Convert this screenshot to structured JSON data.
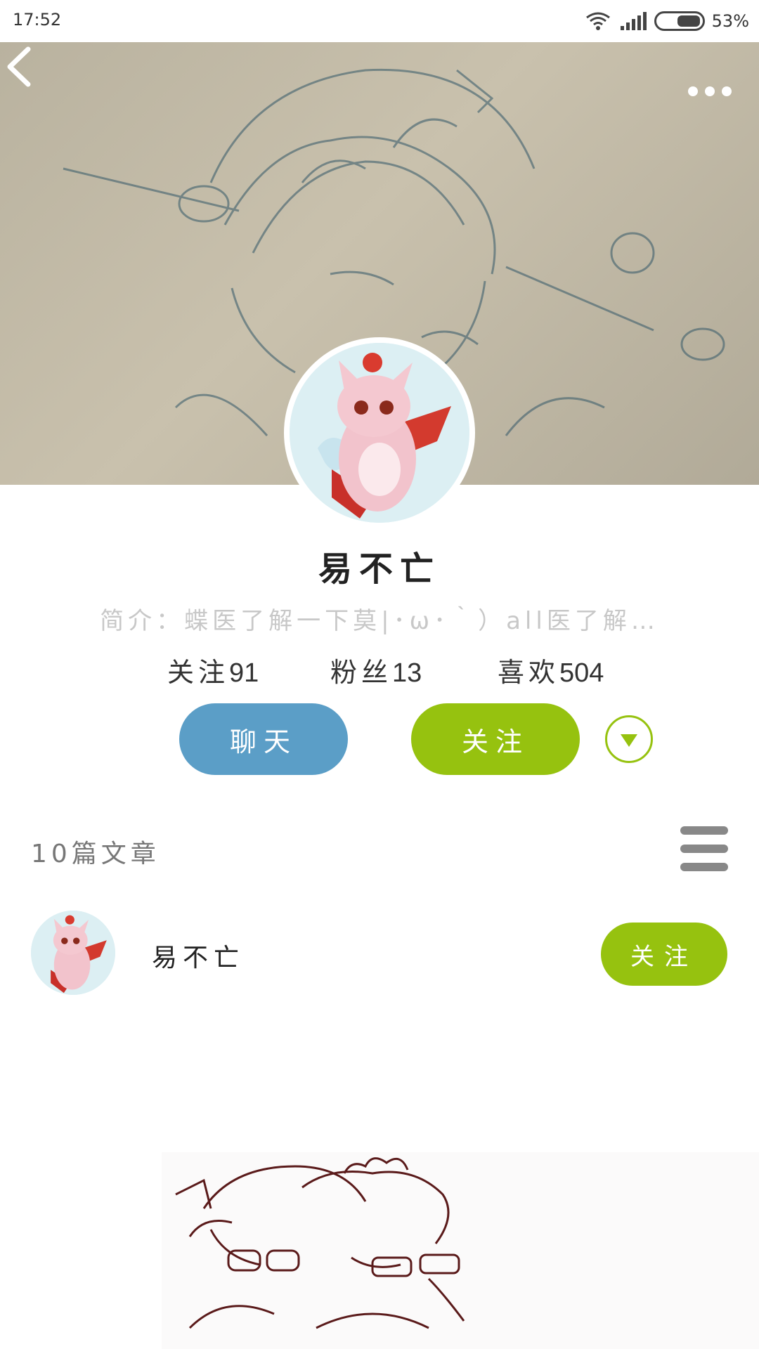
{
  "status_bar": {
    "time": "17:52",
    "battery": "53%"
  },
  "profile": {
    "name": "易不亡",
    "intro": "简介：蝶医了解一下莫|･ω･｀）all医了解…",
    "stats": [
      {
        "label": "关注",
        "value": "91"
      },
      {
        "label": "粉丝",
        "value": "13"
      },
      {
        "label": "喜欢",
        "value": "504"
      }
    ]
  },
  "actions": {
    "chat_label": "聊天",
    "follow_label": "关注"
  },
  "articles": {
    "count_label": "10篇文章",
    "author_name": "易不亡",
    "follow_label": "关注"
  },
  "colors": {
    "accent_green": "#96c20f",
    "chat_blue": "#5b9ec7",
    "cover_tone": "#bdb6a3"
  },
  "icons": {
    "back": "chevron-left-icon",
    "more": "more-horizontal-icon",
    "dropdown": "triangle-down-icon",
    "list": "list-menu-icon"
  }
}
